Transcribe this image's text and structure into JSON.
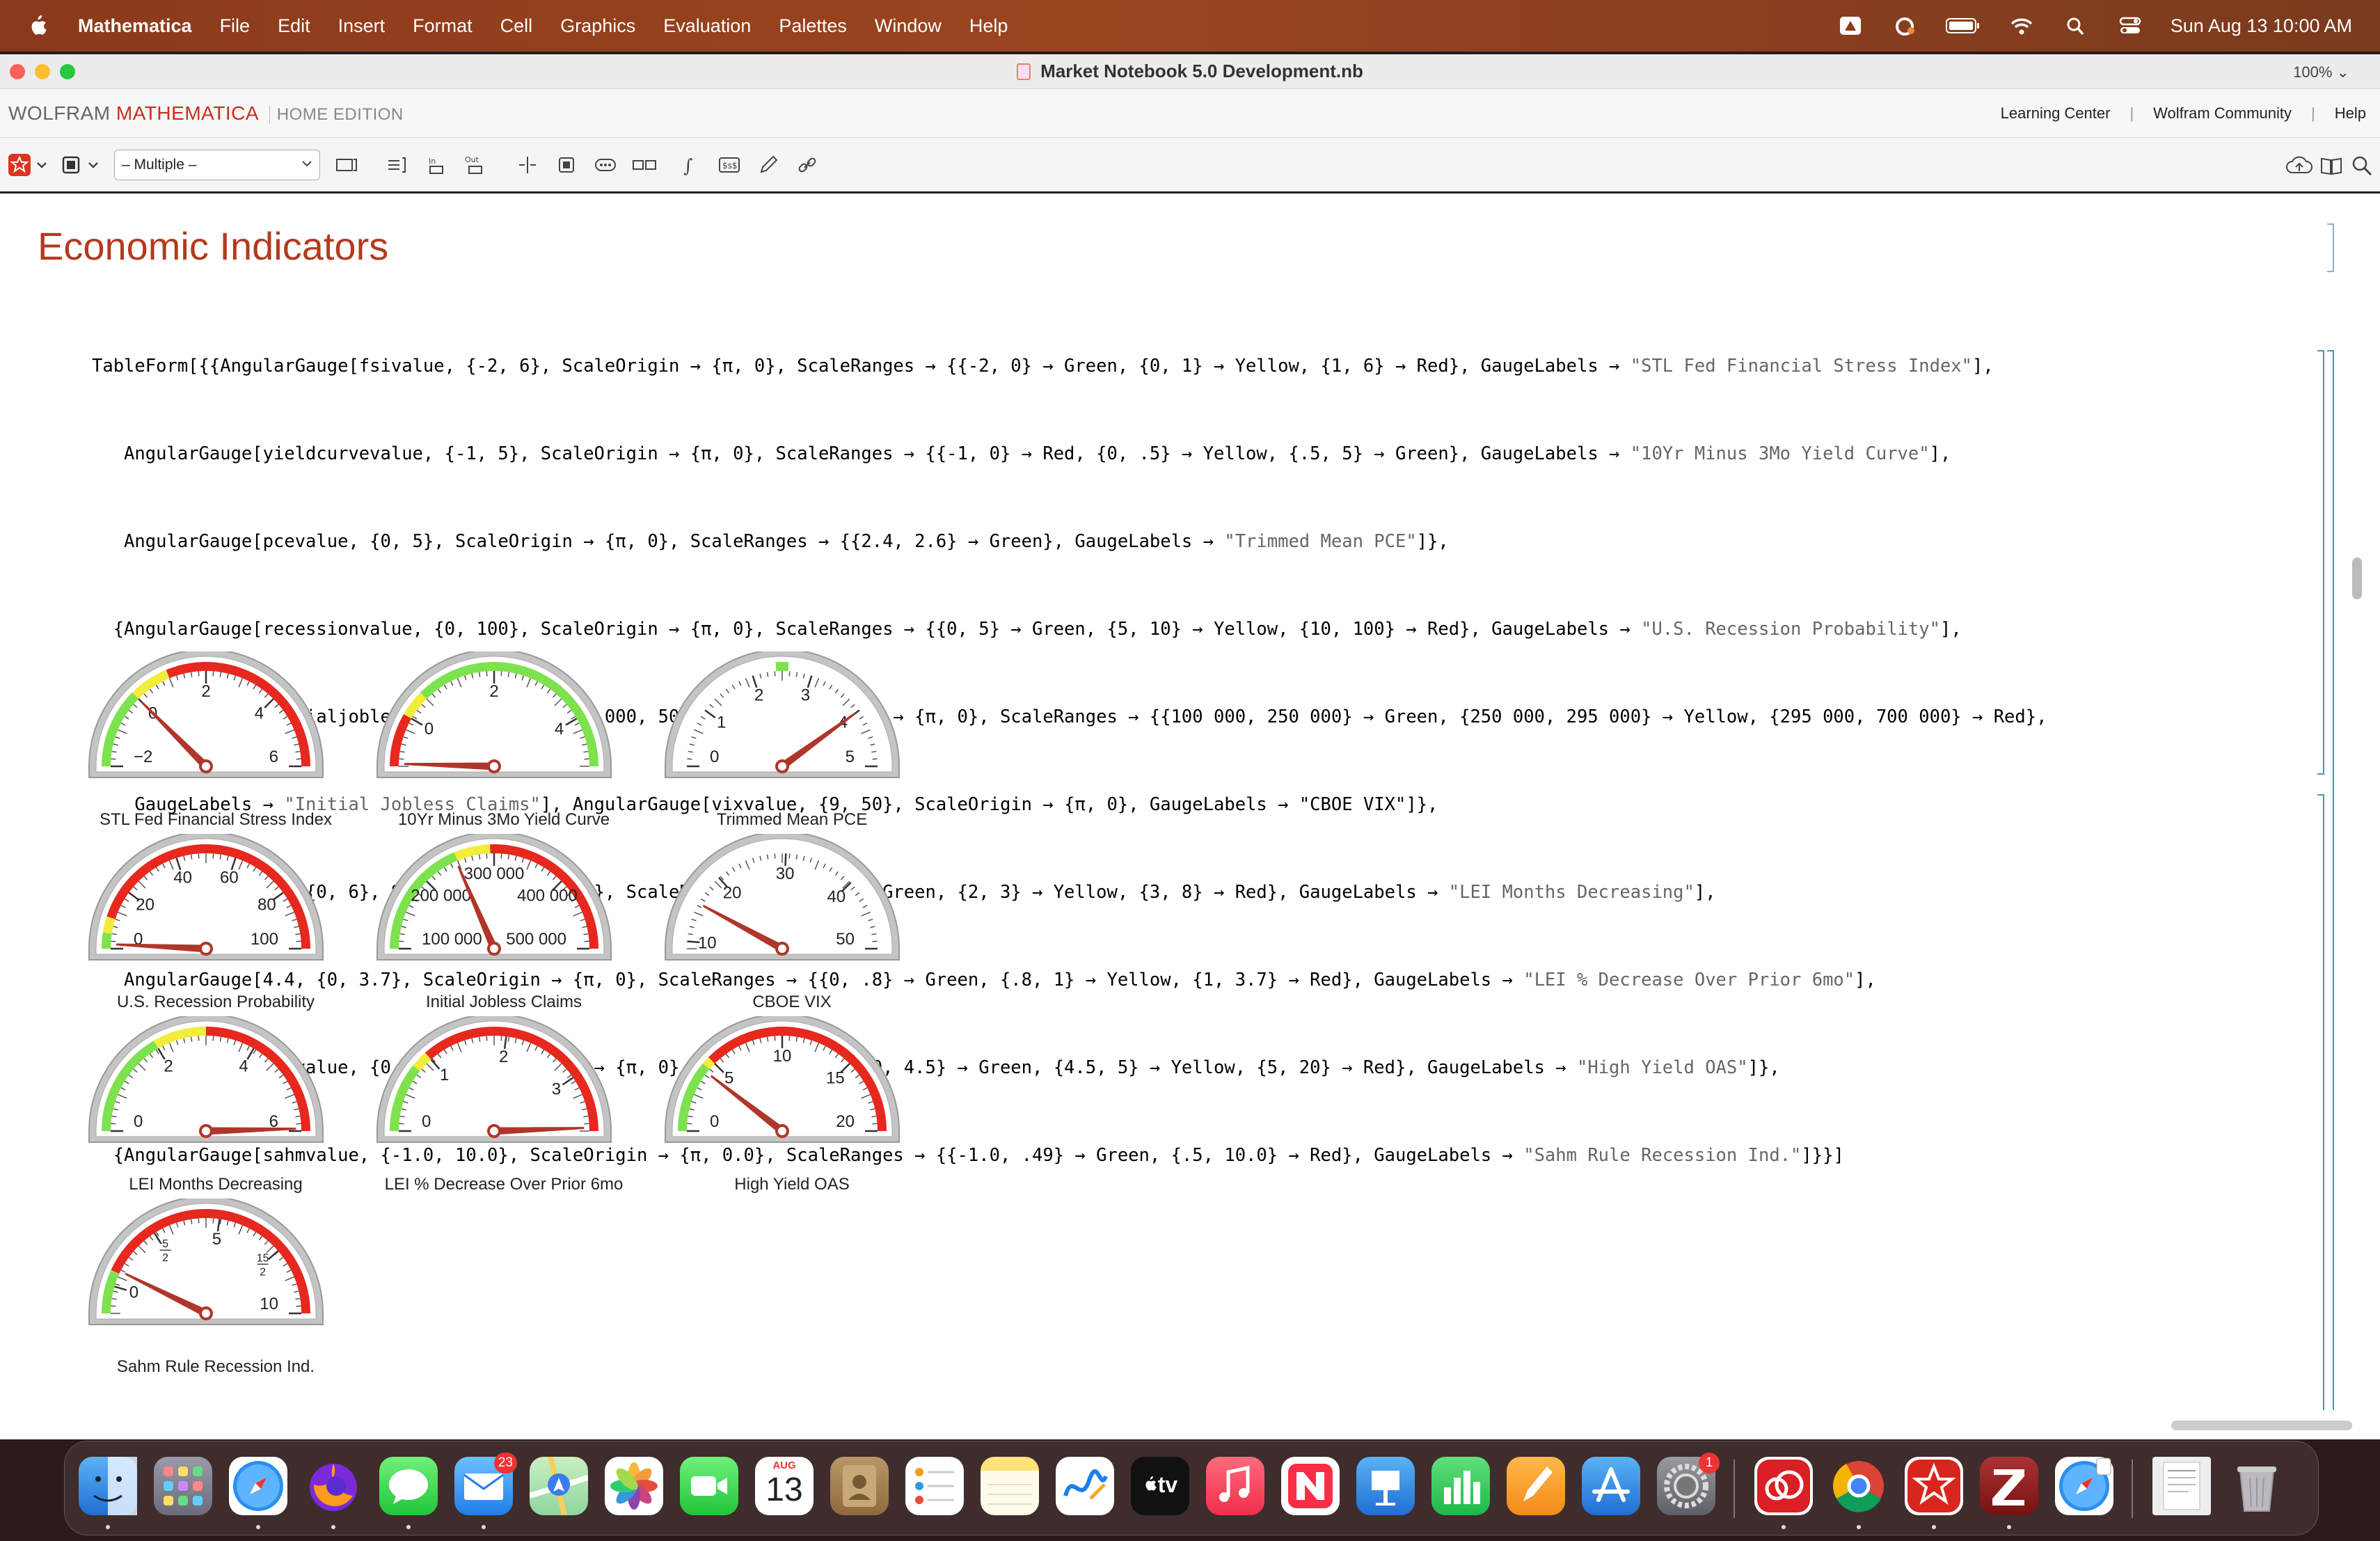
{
  "menubar": {
    "app": "Mathematica",
    "items": [
      "File",
      "Edit",
      "Insert",
      "Format",
      "Cell",
      "Graphics",
      "Evaluation",
      "Palettes",
      "Window",
      "Help"
    ],
    "clock": "Sun Aug 13  10:00 AM"
  },
  "window": {
    "title": "Market Notebook 5.0 Development.nb",
    "zoom": "100% ⌄"
  },
  "brandbar": {
    "wolfram": "WOLFRAM",
    "mathematica": "MATHEMATICA",
    "edition": "HOME EDITION",
    "links": [
      "Learning Center",
      "Wolfram Community",
      "Help"
    ]
  },
  "toolbar": {
    "style_select": "– Multiple –"
  },
  "notebook": {
    "section_title": "Economic Indicators",
    "code_lines": [
      [
        "TableForm[{{AngularGauge[fsivalue, {-2, 6}, ScaleOrigin → {π, 0}, ScaleRanges → {{-2, 0} → Green, {0, 1} → Yellow, {1, 6} → Red}, GaugeLabels → ",
        "\"STL Fed Financial Stress Index\"",
        "],"
      ],
      [
        "   AngularGauge[yieldcurvevalue, {-1, 5}, ScaleOrigin → {π, 0}, ScaleRanges → {{-1, 0} → Red, {0, .5} → Yellow, {.5, 5} → Green}, GaugeLabels → ",
        "\"10Yr Minus 3Mo Yield Curve\"",
        "],"
      ],
      [
        "   AngularGauge[pcevalue, {0, 5}, ScaleOrigin → {π, 0}, ScaleRanges → {{2.4, 2.6} → Green}, GaugeLabels → ",
        "\"Trimmed Mean PCE\"",
        "]},"
      ],
      [
        "  {AngularGauge[recessionvalue, {0, 100}, ScaleOrigin → {π, 0}, ScaleRanges → {{0, 5} → Green, {5, 10} → Yellow, {10, 100} → Red}, GaugeLabels → ",
        "\"U.S. Recession Probability\"",
        "],"
      ],
      [
        "   AngularGauge[initialjoblessclaimsvalue, {100 000, 500 000}, ScaleOrigin → {π, 0}, ScaleRanges → {{100 000, 250 000} → Green, {250 000, 295 000} → Yellow, {295 000, 700 000} → Red},",
        "",
        ""
      ],
      [
        "    GaugeLabels → ",
        "\"Initial Jobless Claims\"",
        "], AngularGauge[vixvalue, {9, 50}, ScaleOrigin → {π, 0}, GaugeLabels → \"CBOE VIX\"]},"
      ],
      [
        "  {AngularGauge[11, {0, 6}, ScaleOrigin → {π, 0}, ScaleRanges → {{0, 2} → Green, {2, 3} → Yellow, {3, 8} → Red}, GaugeLabels → ",
        "\"LEI Months Decreasing\"",
        "],"
      ],
      [
        "   AngularGauge[4.4, {0, 3.7}, ScaleOrigin → {π, 0}, ScaleRanges → {{0, .8} → Green, {.8, 1} → Yellow, {1, 3.7} → Red}, GaugeLabels → ",
        "\"LEI % Decrease Over Prior 6mo\"",
        "],"
      ],
      [
        "   AngularGauge[oasvalue, {0, 20}, ScaleOrigin → {π, 0}, ScaleRanges → {{0, 4.5} → Green, {4.5, 5} → Yellow, {5, 20} → Red}, GaugeLabels → ",
        "\"High Yield OAS\"",
        "]},"
      ],
      [
        "  {AngularGauge[sahmvalue, {-1.0, 10.0}, ScaleOrigin → {π, 0.0}, ScaleRanges → {{-1.0, .49} → Green, {.5, 10.0} → Red}, GaugeLabels → ",
        "\"Sahm Rule Recession Ind.\"",
        "]}}]"
      ]
    ]
  },
  "gauges": [
    {
      "label": "STL Fed Financial Stress Index",
      "min": -2,
      "max": 6,
      "value": 0.0,
      "ranges": [
        [
          -2,
          0,
          "#7de24e"
        ],
        [
          0,
          1,
          "#f2ec3a"
        ],
        [
          1,
          6,
          "#e6281e"
        ]
      ],
      "ticks": [
        {
          "v": -2,
          "t": "−2"
        },
        {
          "v": 0,
          "t": "0"
        },
        {
          "v": 2,
          "t": "2"
        },
        {
          "v": 4,
          "t": "4"
        },
        {
          "v": 6,
          "t": "6"
        }
      ]
    },
    {
      "label": "10Yr Minus 3Mo Yield Curve",
      "min": -1,
      "max": 5,
      "value": -0.95,
      "ranges": [
        [
          -1,
          0,
          "#e6281e"
        ],
        [
          0,
          0.5,
          "#f2ec3a"
        ],
        [
          0.5,
          5,
          "#7de24e"
        ]
      ],
      "ticks": [
        {
          "v": 0,
          "t": "0"
        },
        {
          "v": 2,
          "t": "2"
        },
        {
          "v": 4,
          "t": "4"
        }
      ]
    },
    {
      "label": "Trimmed Mean PCE",
      "min": 0,
      "max": 5,
      "value": 4.0,
      "ranges": [
        [
          2.4,
          2.6,
          "#7de24e"
        ]
      ],
      "ticks": [
        {
          "v": 0,
          "t": "0"
        },
        {
          "v": 1,
          "t": "1"
        },
        {
          "v": 2,
          "t": "2"
        },
        {
          "v": 3,
          "t": "3"
        },
        {
          "v": 4,
          "t": "4"
        },
        {
          "v": 5,
          "t": "5"
        }
      ]
    },
    {
      "label": "U.S. Recession Probability",
      "min": 0,
      "max": 100,
      "value": 1.5,
      "ranges": [
        [
          0,
          5,
          "#7de24e"
        ],
        [
          5,
          10,
          "#f2ec3a"
        ],
        [
          10,
          100,
          "#e6281e"
        ]
      ],
      "ticks": [
        {
          "v": 0,
          "t": "0"
        },
        {
          "v": 20,
          "t": "20"
        },
        {
          "v": 40,
          "t": "40"
        },
        {
          "v": 60,
          "t": "60"
        },
        {
          "v": 80,
          "t": "80"
        },
        {
          "v": 100,
          "t": "100"
        }
      ]
    },
    {
      "label": "Initial Jobless Claims",
      "min": 100000,
      "max": 500000,
      "value": 248000,
      "ranges": [
        [
          100000,
          250000,
          "#7de24e"
        ],
        [
          250000,
          295000,
          "#f2ec3a"
        ],
        [
          295000,
          500000,
          "#e6281e"
        ]
      ],
      "ticks": [
        {
          "v": 100000,
          "t": "100 000"
        },
        {
          "v": 200000,
          "t": "200 000"
        },
        {
          "v": 300000,
          "t": "300 000"
        },
        {
          "v": 400000,
          "t": "400 000"
        },
        {
          "v": 500000,
          "t": "500 000"
        }
      ]
    },
    {
      "label": "CBOE VIX",
      "min": 9,
      "max": 50,
      "value": 15.5,
      "ranges": [],
      "ticks": [
        {
          "v": 10,
          "t": "10"
        },
        {
          "v": 20,
          "t": "20"
        },
        {
          "v": 30,
          "t": "30"
        },
        {
          "v": 40,
          "t": "40"
        },
        {
          "v": 50,
          "t": "50"
        }
      ]
    },
    {
      "label": "LEI Months Decreasing",
      "min": 0,
      "max": 6,
      "value": 5.95,
      "ranges": [
        [
          0,
          2,
          "#7de24e"
        ],
        [
          2,
          3,
          "#f2ec3a"
        ],
        [
          3,
          6,
          "#e6281e"
        ]
      ],
      "ticks": [
        {
          "v": 0,
          "t": "0"
        },
        {
          "v": 2,
          "t": "2"
        },
        {
          "v": 4,
          "t": "4"
        },
        {
          "v": 6,
          "t": "6"
        }
      ]
    },
    {
      "label": "LEI % Decrease Over Prior 6mo",
      "min": 0,
      "max": 3.7,
      "value": 3.66,
      "ranges": [
        [
          0,
          0.8,
          "#7de24e"
        ],
        [
          0.8,
          1,
          "#f2ec3a"
        ],
        [
          1,
          3.7,
          "#e6281e"
        ]
      ],
      "ticks": [
        {
          "v": 0,
          "t": "0"
        },
        {
          "v": 1,
          "t": "1"
        },
        {
          "v": 2,
          "t": "2"
        },
        {
          "v": 3,
          "t": "3"
        }
      ]
    },
    {
      "label": "High Yield OAS",
      "min": 0,
      "max": 20,
      "value": 4.2,
      "ranges": [
        [
          0,
          4.5,
          "#7de24e"
        ],
        [
          4.5,
          5,
          "#f2ec3a"
        ],
        [
          5,
          20,
          "#e6281e"
        ]
      ],
      "ticks": [
        {
          "v": 0,
          "t": "0"
        },
        {
          "v": 5,
          "t": "5"
        },
        {
          "v": 10,
          "t": "10"
        },
        {
          "v": 15,
          "t": "15"
        },
        {
          "v": 20,
          "t": "20"
        }
      ]
    },
    {
      "label": "Sahm Rule Recession Ind.",
      "min": -1,
      "max": 10,
      "value": 0.6,
      "ranges": [
        [
          -1,
          0.49,
          "#7de24e"
        ],
        [
          0.5,
          10,
          "#e6281e"
        ]
      ],
      "ticks": [
        {
          "v": 0,
          "t": "0"
        },
        {
          "v": 2.5,
          "t": "5/2"
        },
        {
          "v": 5,
          "t": "5"
        },
        {
          "v": 7.5,
          "t": "15/2"
        },
        {
          "v": 10,
          "t": "10"
        }
      ]
    }
  ],
  "dock": {
    "mail_badge": "23",
    "calendar_month": "AUG",
    "calendar_day": "13",
    "settings_badge": "1",
    "tv_label": "tv"
  },
  "colors": {
    "section": "#b5391e",
    "needle": "#b0362a",
    "gauge_bezel": "#c8c8c8"
  }
}
